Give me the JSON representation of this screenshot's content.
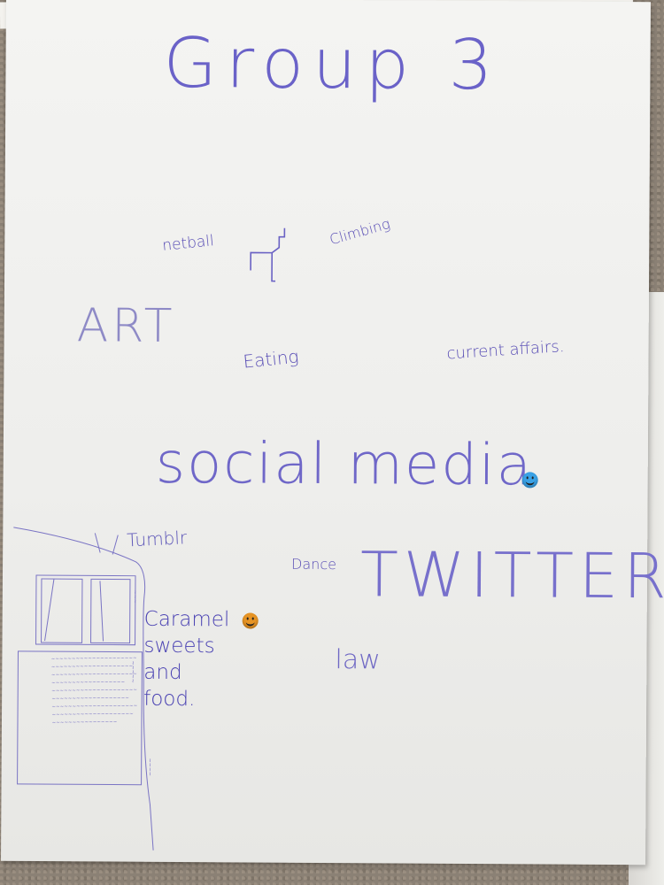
{
  "title": "Group 3",
  "words": {
    "netball": "netball",
    "climbing": "Climbing",
    "art": "ART",
    "eating": "Eating",
    "current_affairs": "current affairs.",
    "social_media": "social media",
    "tumblr": "Tumblr",
    "dance": "Dance",
    "twitter": "TWITTER",
    "caramel": "Caramel\nsweets\nand\nfood.",
    "law": "law"
  },
  "colors": {
    "ink": "#5a4fb6",
    "paper": "#f1f1ef",
    "smiley_blue": "#3aa2e6",
    "smiley_orange": "#e79424"
  },
  "icons": [
    "blue-smiley-sticker-icon",
    "orange-smiley-sticker-icon",
    "climbing-wall-drawing-icon"
  ]
}
